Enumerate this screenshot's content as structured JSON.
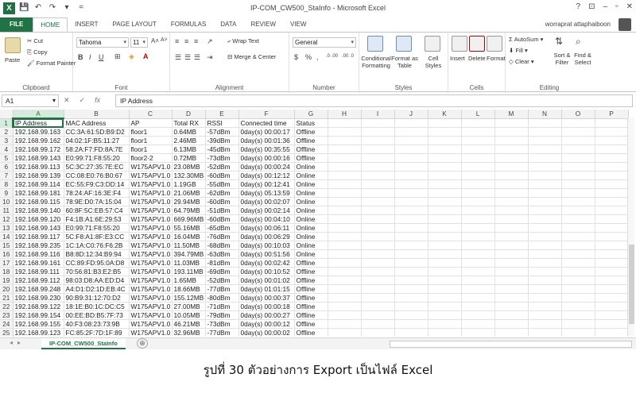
{
  "window": {
    "title": "IP-COM_CW500_StaInfo - Microsoft Excel",
    "app_logo": "X",
    "user": "worraprat attaphaiboon",
    "controls": [
      "?",
      "⊡",
      "–",
      "▫",
      "✕"
    ]
  },
  "qat": [
    "💾",
    "↶",
    "↷",
    "▾",
    "="
  ],
  "tabs": [
    "FILE",
    "HOME",
    "INSERT",
    "PAGE LAYOUT",
    "FORMULAS",
    "DATA",
    "REVIEW",
    "VIEW"
  ],
  "active_tab": "HOME",
  "ribbon": {
    "clipboard": {
      "label": "Clipboard",
      "paste": "Paste",
      "cut": "Cut",
      "copy": "Copy",
      "format_painter": "Format Painter"
    },
    "font": {
      "label": "Font",
      "name": "Tahoma",
      "size": "11",
      "grow": "A˄",
      "shrink": "A˅",
      "bold": "B",
      "italic": "I",
      "underline": "U"
    },
    "alignment": {
      "label": "Alignment",
      "wrap": "Wrap Text",
      "merge": "Merge & Center"
    },
    "number": {
      "label": "Number",
      "format": "General",
      "currency": "$",
      "percent": "%",
      "comma": ",",
      "inc": ".0 .00",
      "dec": ".00 .0"
    },
    "styles": {
      "label": "Styles",
      "conditional": "Conditional Formatting",
      "format_table": "Format as Table",
      "cell_styles": "Cell Styles"
    },
    "cells": {
      "label": "Cells",
      "insert": "Insert",
      "delete": "Delete",
      "format": "Format"
    },
    "editing": {
      "label": "Editing",
      "autosum": "AutoSum",
      "fill": "Fill",
      "clear": "Clear",
      "sort": "Sort & Filter",
      "find": "Find & Select"
    }
  },
  "formula_bar": {
    "name_box": "A1",
    "cancel": "✕",
    "enter": "✓",
    "fx": "fx",
    "value": "IP Address"
  },
  "columns": [
    "A",
    "B",
    "C",
    "D",
    "E",
    "F",
    "G",
    "H",
    "I",
    "J",
    "K",
    "L",
    "M",
    "N",
    "O",
    "P"
  ],
  "rows": [
    [
      "IP Address",
      "MAC Address",
      "AP",
      "Total RX",
      "RSSI",
      "Connected time",
      "Status"
    ],
    [
      "192.168.99.163",
      "CC:3A:61:5D:B9:D2",
      "floor1",
      "0.64MB",
      "-57dBm",
      "0day(s) 00:00:17",
      "Offline"
    ],
    [
      "192.168.99.162",
      "04:02:1F:B5:11:27",
      "floor1",
      "2.46MB",
      "-39dBm",
      "0day(s) 00:01:36",
      "Offline"
    ],
    [
      "192.168.99.172",
      "58:2A:F7:FD:8A:7E",
      "floor1",
      "6.13MB",
      "-45dBm",
      "0day(s) 00:35:55",
      "Offline"
    ],
    [
      "192.168.99.143",
      "E0:99:71:F8:55:20",
      "floor2-2",
      "0.72MB",
      "-73dBm",
      "0day(s) 00:00:16",
      "Offline"
    ],
    [
      "192.168.99.113",
      "5C:3C:27:35:7E:EC",
      "W175APV1.0",
      "23.08MB",
      "-52dBm",
      "0day(s) 00:00:24",
      "Online"
    ],
    [
      "192.168.99.139",
      "CC:08:E0:76:B0:67",
      "W175APV1.0",
      "132.30MB",
      "-60dBm",
      "0day(s) 00:12:12",
      "Online"
    ],
    [
      "192.168.99.114",
      "EC:55:F9:C3:DD:14",
      "W175APV1.0",
      "1.19GB",
      "-55dBm",
      "0day(s) 00:12:41",
      "Online"
    ],
    [
      "192.168.99.181",
      "78:24:AF:16:3E:F4",
      "W175APV1.0",
      "21.06MB",
      "-62dBm",
      "0day(s) 05:13:59",
      "Online"
    ],
    [
      "192.168.99.115",
      "78:9E:D0:7A:15:04",
      "W175APV1.0",
      "29.94MB",
      "-60dBm",
      "0day(s) 00:02:07",
      "Online"
    ],
    [
      "192.168.99.140",
      "60:8F:5C:EB:57:C4",
      "W175APV1.0",
      "64.79MB",
      "-51dBm",
      "0day(s) 00:02:14",
      "Online"
    ],
    [
      "192.168.99.120",
      "F4:1B:A1:6E:29:53",
      "W175APV1.0",
      "669.96MB",
      "-60dBm",
      "0day(s) 00:04:10",
      "Online"
    ],
    [
      "192.168.99.143",
      "E0:99:71:F8:55:20",
      "W175APV1.0",
      "55.16MB",
      "-65dBm",
      "0day(s) 00:06:11",
      "Online"
    ],
    [
      "192.168.99.117",
      "5C:F8:A1:8F:E3:CC",
      "W175APV1.0",
      "16.04MB",
      "-76dBm",
      "0day(s) 00:06:29",
      "Online"
    ],
    [
      "192.168.99.235",
      "1C:1A:C0:76:F6:2B",
      "W175APV1.0",
      "11.50MB",
      "-68dBm",
      "0day(s) 00:10:03",
      "Online"
    ],
    [
      "192.168.99.116",
      "B8:8D:12:34:B9:94",
      "W175APV1.0",
      "394.79MB",
      "-63dBm",
      "0day(s) 00:51:56",
      "Online"
    ],
    [
      "192.168.99.161",
      "CC:89:FD:95:0A:D8",
      "W175APV1.0",
      "11.03MB",
      "-81dBm",
      "0day(s) 00:02:42",
      "Offline"
    ],
    [
      "192.168.99.111",
      "70:56:81:B3:E2:B5",
      "W175APV1.0",
      "193.11MB",
      "-69dBm",
      "0day(s) 00:10:52",
      "Offline"
    ],
    [
      "192.168.99.112",
      "98:03:D8:AA:ED:D4",
      "W175APV1.0",
      "1.65MB",
      "-52dBm",
      "0day(s) 00:01:02",
      "Offline"
    ],
    [
      "192.168.99.248",
      "A4:D1:D2:1D:EB:4C",
      "W175APV1.0",
      "18.66MB",
      "-77dBm",
      "0day(s) 01:01:15",
      "Offline"
    ],
    [
      "192.168.99.230",
      "90:B9:31:12:70:D2",
      "W175APV1.0",
      "155.12MB",
      "-80dBm",
      "0day(s) 00:00:37",
      "Offline"
    ],
    [
      "192.168.99.122",
      "18:1E:B0:1C:DC:C5",
      "W175APV1.0",
      "27.00MB",
      "-71dBm",
      "0day(s) 00:00:18",
      "Offline"
    ],
    [
      "192.168.99.154",
      "00:EE:BD:B5:7F:73",
      "W175APV1.0",
      "10.05MB",
      "-79dBm",
      "0day(s) 00:00:27",
      "Offline"
    ],
    [
      "192.168.99.155",
      "40:F3:08:23:73:9B",
      "W175APV1.0",
      "46.21MB",
      "-73dBm",
      "0day(s) 00:00:12",
      "Offline"
    ],
    [
      "192.168.99.123",
      "FC:85:2F:7D:1F:89",
      "W175APV1.0",
      "32.96MB",
      "-77dBm",
      "0day(s) 00:00:02",
      "Offline"
    ]
  ],
  "sheet_tab": "IP-COM_CW500_StaInfo",
  "add_sheet": "⊕",
  "caption": "รูปที่ 30 ตัวอย่างการ Export เป็นไฟล์ Excel",
  "colors": {
    "excel_green": "#217346",
    "selection": "#d6ebdc",
    "gridline": "#e2e2e2"
  }
}
